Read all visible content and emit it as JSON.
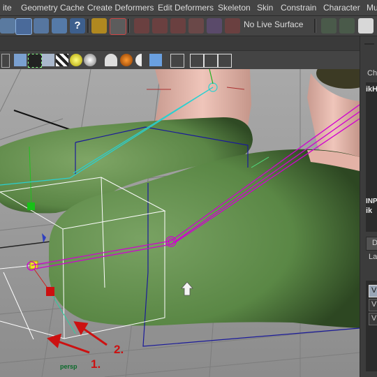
{
  "menubar": {
    "items": [
      "ite",
      "Geometry Cache",
      "Create Deformers",
      "Edit Deformers",
      "Skeleton",
      "Skin",
      "Constrain",
      "Character",
      "Mu"
    ]
  },
  "shelf": {
    "live_surface_label": "No Live Surface"
  },
  "viewport": {
    "camera_label": "persp",
    "annotation_1": "1.",
    "annotation_2": "2."
  },
  "right_panel": {
    "label_cha": "Cha",
    "label_ikh": "ikH",
    "label_inp": "INP",
    "label_ik": "ik",
    "tab_d": "D",
    "label_la": "La",
    "layer_v1": "V",
    "layer_v2": "V",
    "layer_v3": "V"
  },
  "colors": {
    "menu_bg": "#444444",
    "viewport_bg": "#959595",
    "shoe_green": "#5d8a48",
    "leg_skin": "#e3b2a6",
    "ik_magenta": "#d000d0",
    "ik_cyan": "#2ad0d0",
    "annotation_red": "#cc1111"
  }
}
